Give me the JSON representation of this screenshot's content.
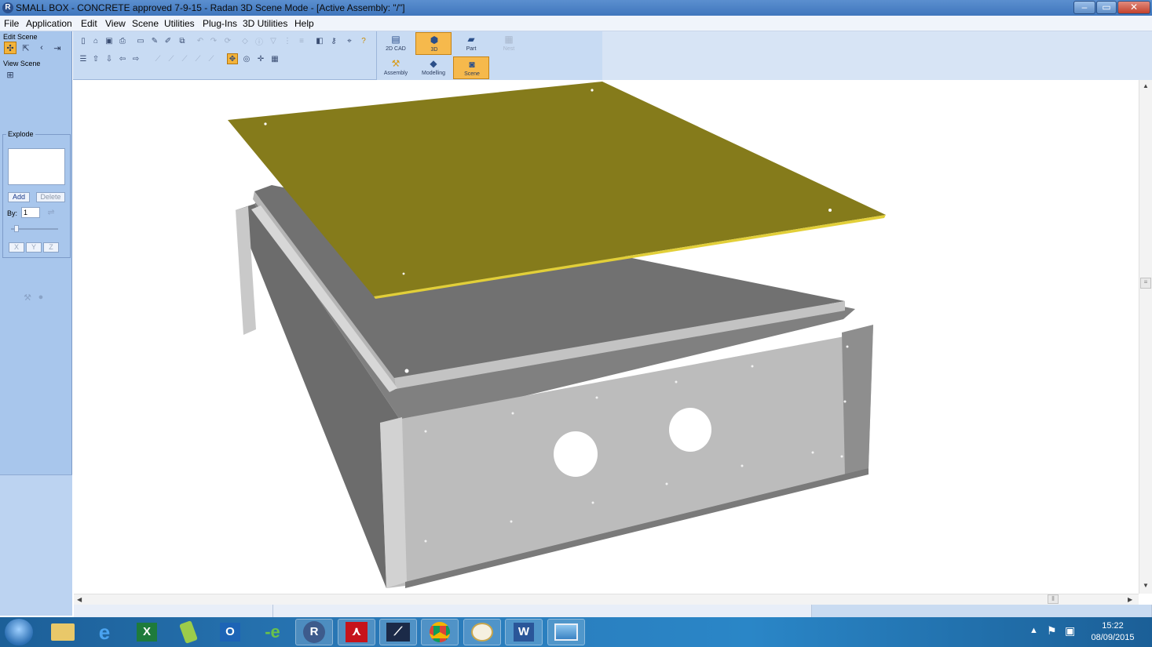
{
  "window": {
    "title": "SMALL BOX - CONCRETE approved 7-9-15 - Radan 3D Scene Mode - [Active Assembly: \"/\"]",
    "app_icon": "R"
  },
  "menu": [
    "File",
    "Application",
    "Edit",
    "View",
    "Scene",
    "Utilities",
    "Plug-Ins",
    "3D Utilities",
    "Help"
  ],
  "left_panel": {
    "edit_scene_label": "Edit Scene",
    "view_scene_label": "View Scene",
    "explode": {
      "title": "Explode",
      "add_label": "Add",
      "delete_label": "Delete",
      "by_label": "By:",
      "by_value": "1",
      "axes": [
        "X",
        "Y",
        "Z"
      ]
    }
  },
  "modes": {
    "top": [
      {
        "label": "2D CAD",
        "icon": "2d-cad-icon"
      },
      {
        "label": "3D",
        "icon": "3d-icon",
        "active": true
      },
      {
        "label": "Part",
        "icon": "part-icon"
      },
      {
        "label": "Nest",
        "icon": "nest-icon",
        "disabled": true
      }
    ],
    "bottom": [
      {
        "label": "Assembly",
        "icon": "wrench-icon"
      },
      {
        "label": "Modelling",
        "icon": "modelling-icon"
      },
      {
        "label": "Scene",
        "icon": "camera-icon",
        "active": true
      }
    ]
  },
  "taskbar": {
    "apps": [
      "Windows Explorer",
      "Internet Explorer",
      "Excel",
      "Tool",
      "Outlook",
      "Edge",
      "Radan",
      "Adobe Reader",
      "Inventor",
      "Chrome",
      "Paint",
      "Word",
      "Photos"
    ],
    "time": "15:22",
    "date": "08/09/2015"
  },
  "colors": {
    "plate": "#857b1b",
    "box_dark": "#6c6c6c",
    "box_light": "#bdbdbd",
    "accent": "#f3b33a"
  }
}
